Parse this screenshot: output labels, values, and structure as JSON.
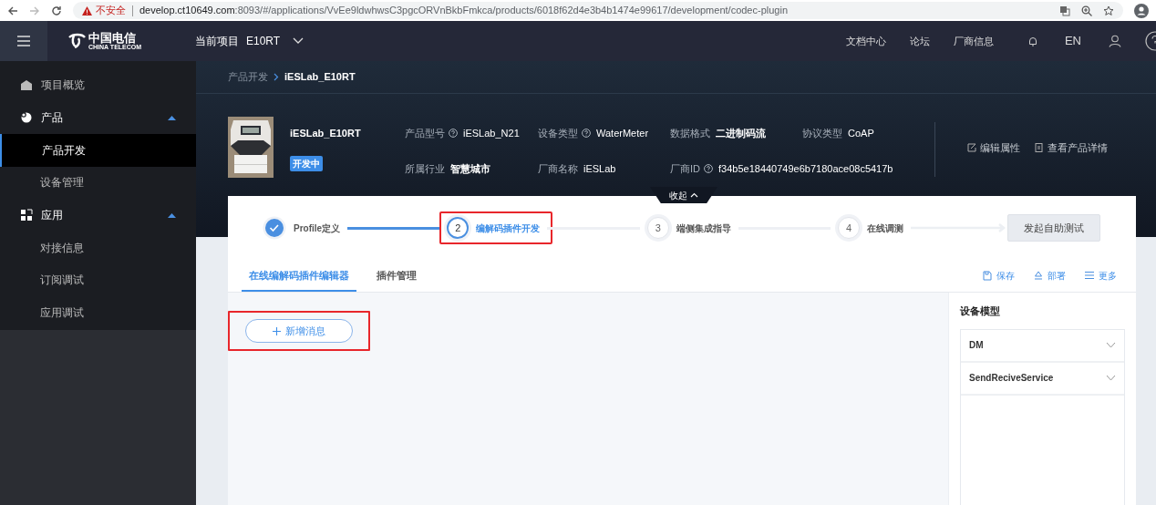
{
  "browser": {
    "security": "不安全",
    "url_host": "develop.ct10649.com",
    "url_rest": ":8093/#/applications/VvEe9ldwhwsC3pgcORVnBkbFmkca/products/6018f62d4e3b4b1474e99617/development/codec-plugin"
  },
  "topbar": {
    "logo_cn": "中国电信",
    "logo_en": "CHINA TELECOM",
    "project_label": "当前项目",
    "project": "E10RT",
    "links": [
      "文档中心",
      "论坛",
      "厂商信息"
    ],
    "lang": "EN"
  },
  "sidebar": {
    "items": [
      {
        "label": "项目概览",
        "selected": false
      },
      {
        "label": "产品",
        "expanded": true,
        "selected": false,
        "children": [
          {
            "label": "产品开发",
            "selected": true
          },
          {
            "label": "设备管理",
            "selected": false
          }
        ]
      },
      {
        "label": "应用",
        "expanded": true,
        "selected": false,
        "children": [
          {
            "label": "对接信息",
            "selected": false
          },
          {
            "label": "订阅调试",
            "selected": false
          },
          {
            "label": "应用调试",
            "selected": false
          }
        ]
      }
    ]
  },
  "breadcrumb": [
    "产品开发",
    "iESLab_E10RT"
  ],
  "product": {
    "name": "iESLab_E10RT",
    "status": "开发中",
    "fields": [
      {
        "label": "产品型号",
        "help": true,
        "value": "iESLab_N21",
        "strong": false
      },
      {
        "label": "设备类型",
        "help": true,
        "value": "WaterMeter",
        "strong": false
      },
      {
        "label": "数据格式",
        "help": false,
        "value": "二进制码流",
        "strong": true
      },
      {
        "label": "协议类型",
        "help": false,
        "value": "CoAP",
        "strong": false
      },
      {
        "label": "所属行业",
        "help": false,
        "value": "智慧城市",
        "strong": true
      },
      {
        "label": "厂商名称",
        "help": false,
        "value": "iESLab",
        "strong": false
      },
      {
        "label": "厂商ID",
        "help": true,
        "value": "f34b5e18440749e6b7180ace08c5417b",
        "strong": false
      }
    ],
    "actions": [
      "编辑属性",
      "查看产品详情"
    ],
    "collapse": "收起"
  },
  "steps": [
    {
      "label": "Profile定义",
      "done": true,
      "active": false,
      "highlighted": false
    },
    {
      "number": "2",
      "label": "编解码插件开发",
      "done": false,
      "active": true,
      "highlighted": true
    },
    {
      "number": "3",
      "label": "端侧集成指导",
      "done": false,
      "active": false,
      "highlighted": false
    },
    {
      "number": "4",
      "label": "在线调测",
      "done": false,
      "active": false,
      "highlighted": false
    }
  ],
  "start_test": "发起自助测试",
  "tabs": [
    {
      "label": "在线编解码插件编辑器",
      "selected": true
    },
    {
      "label": "插件管理",
      "selected": false
    }
  ],
  "toolbar": [
    "保存",
    "部署",
    "更多"
  ],
  "add_message": {
    "label": "新增消息",
    "highlighted": true
  },
  "model_panel": {
    "title": "设备模型",
    "items": [
      {
        "name": "DM",
        "expanded": false
      },
      {
        "name": "SendReciveService",
        "expanded": false
      }
    ]
  }
}
